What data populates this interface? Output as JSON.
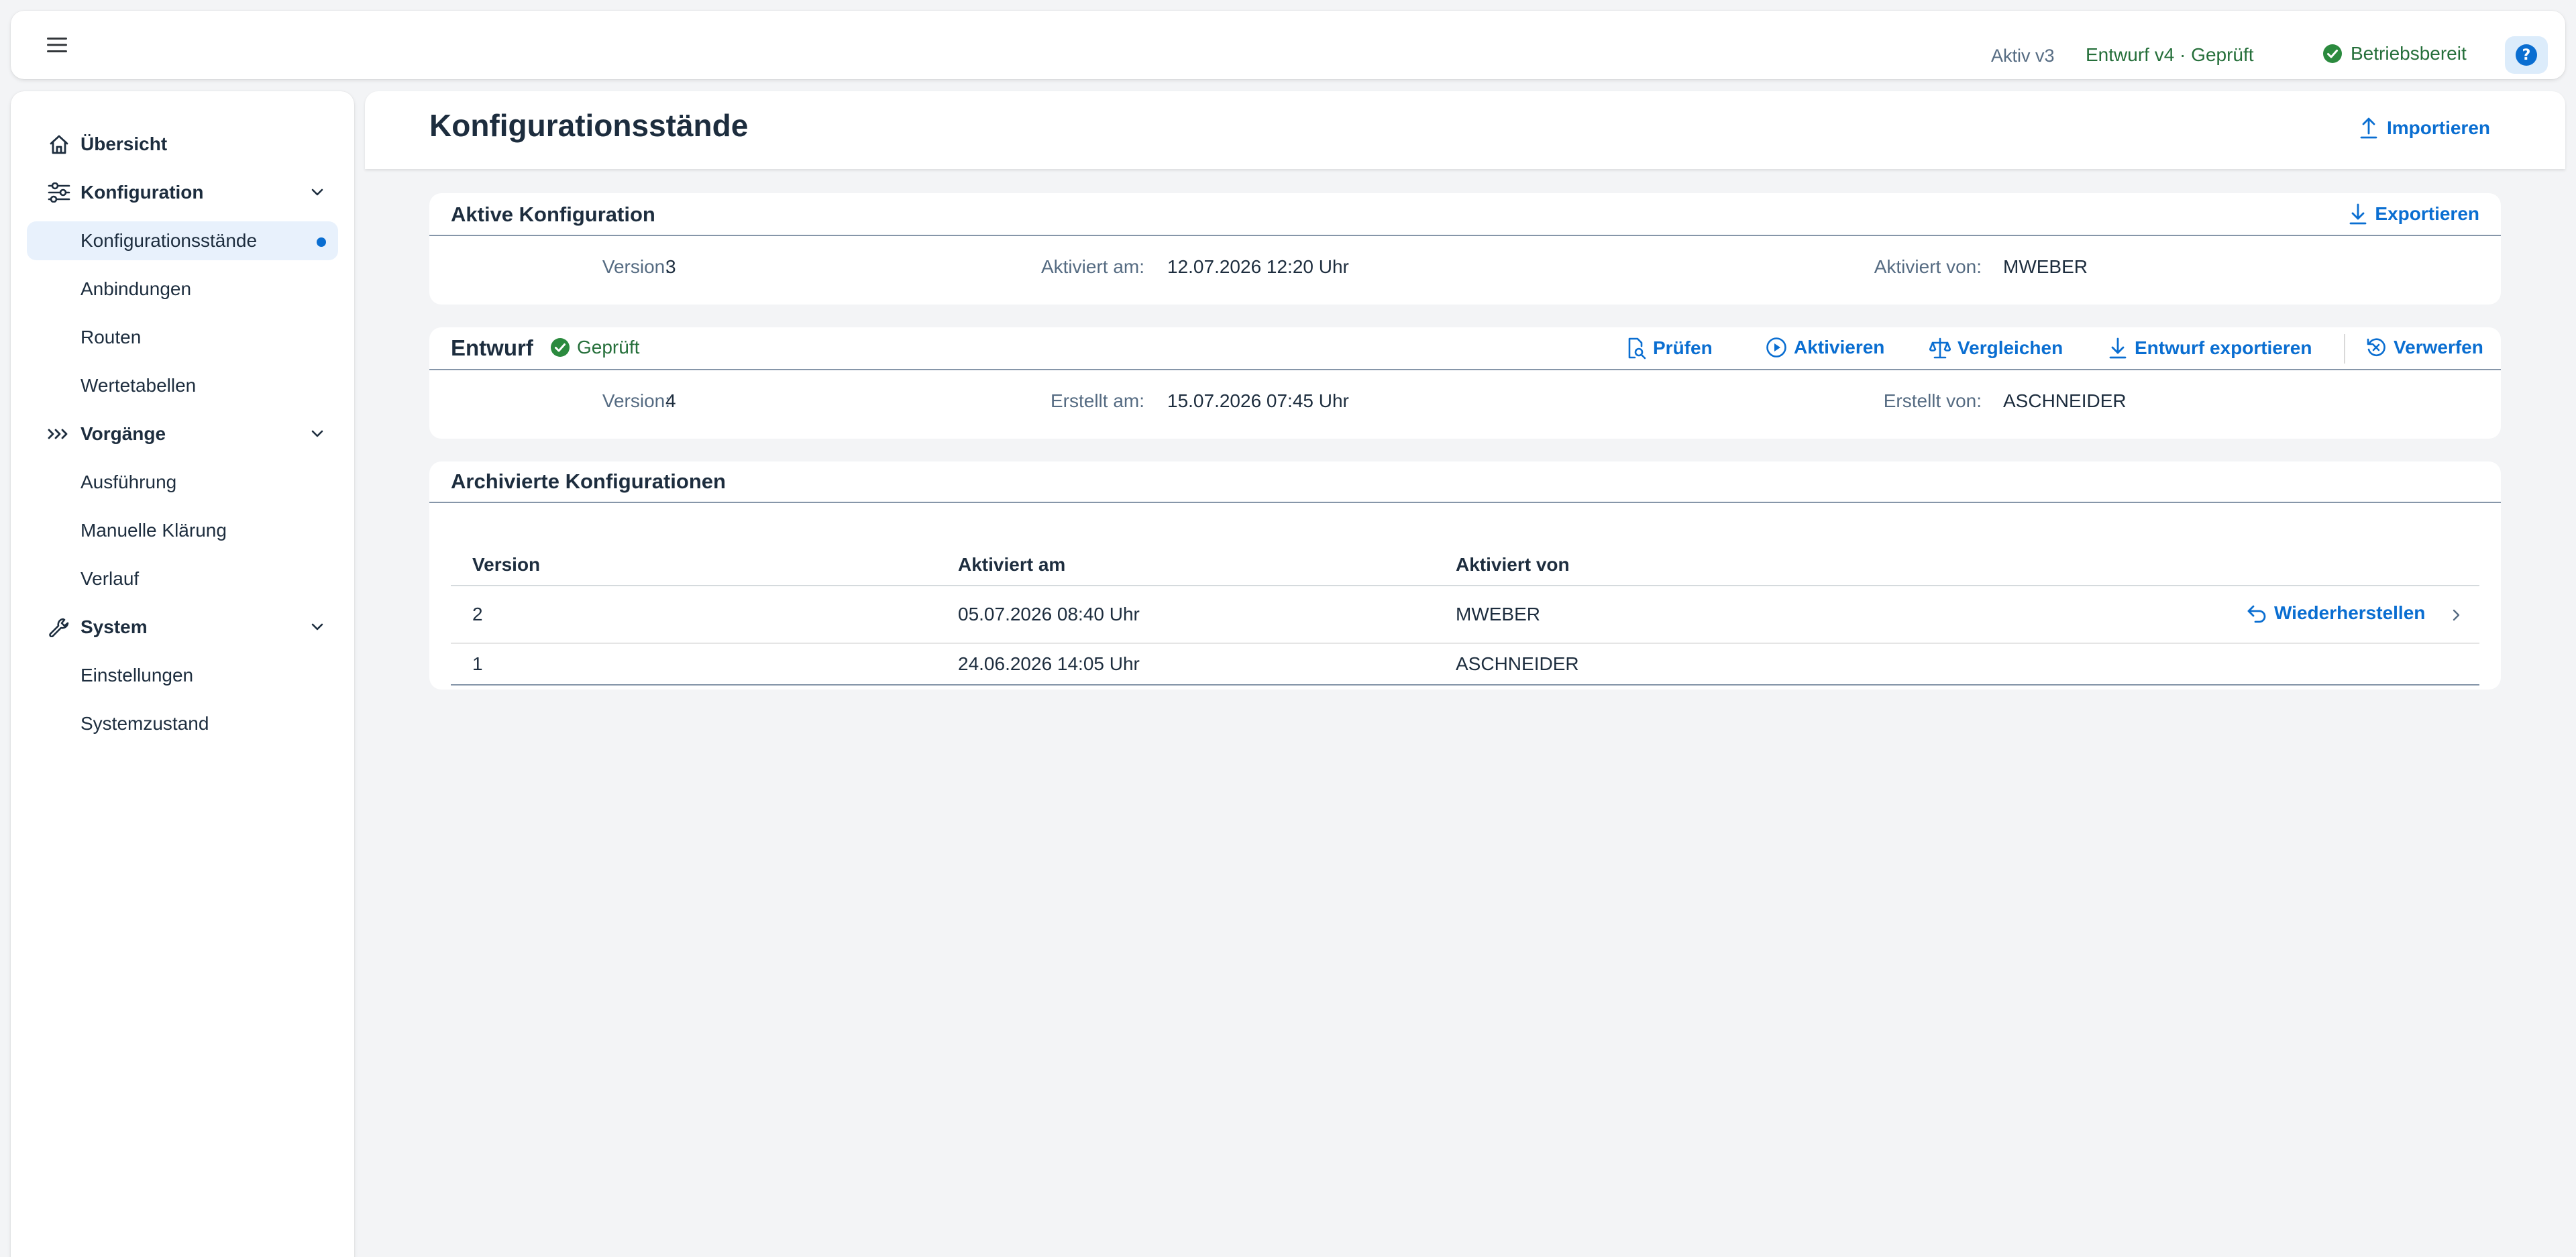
{
  "shell": {
    "menu_icon": "hamburger-menu-icon",
    "active_version": "Aktiv v3",
    "draft_status": "Entwurf v4 · Geprüft",
    "system_status": "Betriebsbereit",
    "help_icon": "help-icon",
    "colors": {
      "success": "#256f3a",
      "accent": "#0a6ed1"
    }
  },
  "sidebar": {
    "items": [
      {
        "label": "Übersicht",
        "type": "group",
        "icon": "home-icon"
      },
      {
        "label": "Konfiguration",
        "type": "group",
        "icon": "sliders-icon",
        "expanded": true
      },
      {
        "label": "Konfigurationsstände",
        "type": "child",
        "selected": true
      },
      {
        "label": "Anbindungen",
        "type": "child"
      },
      {
        "label": "Routen",
        "type": "child"
      },
      {
        "label": "Wertetabellen",
        "type": "child"
      },
      {
        "label": "Vorgänge",
        "type": "group",
        "icon": "process-icon",
        "expanded": true
      },
      {
        "label": "Ausführung",
        "type": "child"
      },
      {
        "label": "Manuelle Klärung",
        "type": "child"
      },
      {
        "label": "Verlauf",
        "type": "child"
      },
      {
        "label": "System",
        "type": "group",
        "icon": "wrench-icon",
        "expanded": true
      },
      {
        "label": "Einstellungen",
        "type": "child"
      },
      {
        "label": "Systemzustand",
        "type": "child"
      }
    ]
  },
  "page": {
    "title": "Konfigurationsstände",
    "import_label": "Importieren"
  },
  "active_config": {
    "title": "Aktive Konfiguration",
    "export_label": "Exportieren",
    "version_label": "Version:",
    "version_value": "3",
    "activated_at_label": "Aktiviert am:",
    "activated_at_value": "12.07.2026 12:20 Uhr",
    "activated_by_label": "Aktiviert von:",
    "activated_by_value": "MWEBER"
  },
  "draft": {
    "title": "Entwurf",
    "status": "Geprüft",
    "actions": {
      "check": "Prüfen",
      "activate": "Aktivieren",
      "compare": "Vergleichen",
      "export": "Entwurf exportieren",
      "discard": "Verwerfen"
    },
    "version_label": "Version:",
    "version_value": "4",
    "created_at_label": "Erstellt am:",
    "created_at_value": "15.07.2026 07:45 Uhr",
    "created_by_label": "Erstellt von:",
    "created_by_value": "ASCHNEIDER"
  },
  "archive": {
    "title": "Archivierte Konfigurationen",
    "columns": [
      "Version",
      "Aktiviert am",
      "Aktiviert von"
    ],
    "restore_label": "Wiederherstellen",
    "rows": [
      {
        "version": "2",
        "activated_at": "05.07.2026 08:40 Uhr",
        "activated_by": "MWEBER"
      },
      {
        "version": "1",
        "activated_at": "24.06.2026 14:05 Uhr",
        "activated_by": "ASCHNEIDER"
      }
    ]
  }
}
